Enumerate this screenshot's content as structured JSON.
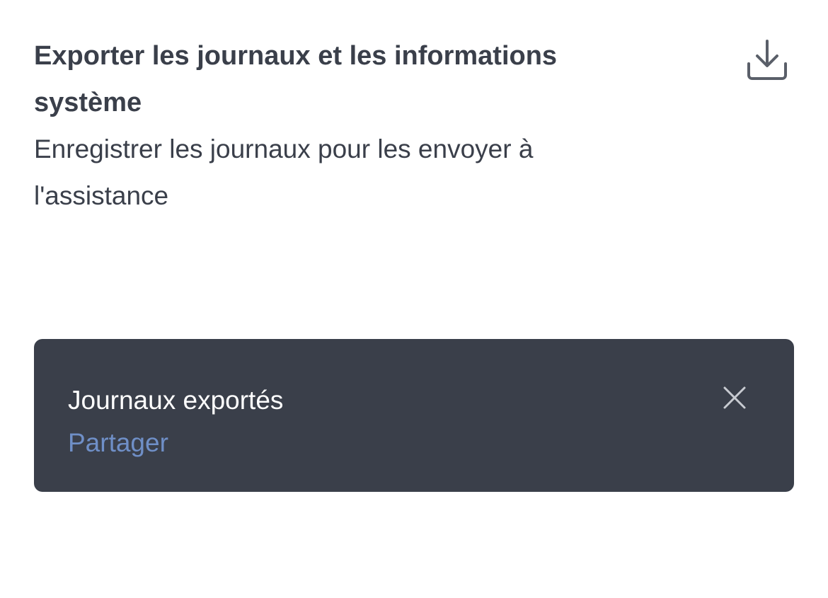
{
  "export_logs": {
    "title": "Exporter les journaux et les informations système",
    "description": "Enregistrer les journaux pour les envoyer à l'assistance",
    "icon": "download-icon"
  },
  "snackbar": {
    "message": "Journaux exportés",
    "action_label": "Partager",
    "close_icon": "close-icon"
  },
  "colors": {
    "text": "#3a3f4a",
    "snackbar_background": "#3a3f4a",
    "snackbar_text": "#ffffff",
    "action": "#6f8fc7",
    "icon": "#5a5f69",
    "close_icon": "#c8cbd1"
  }
}
